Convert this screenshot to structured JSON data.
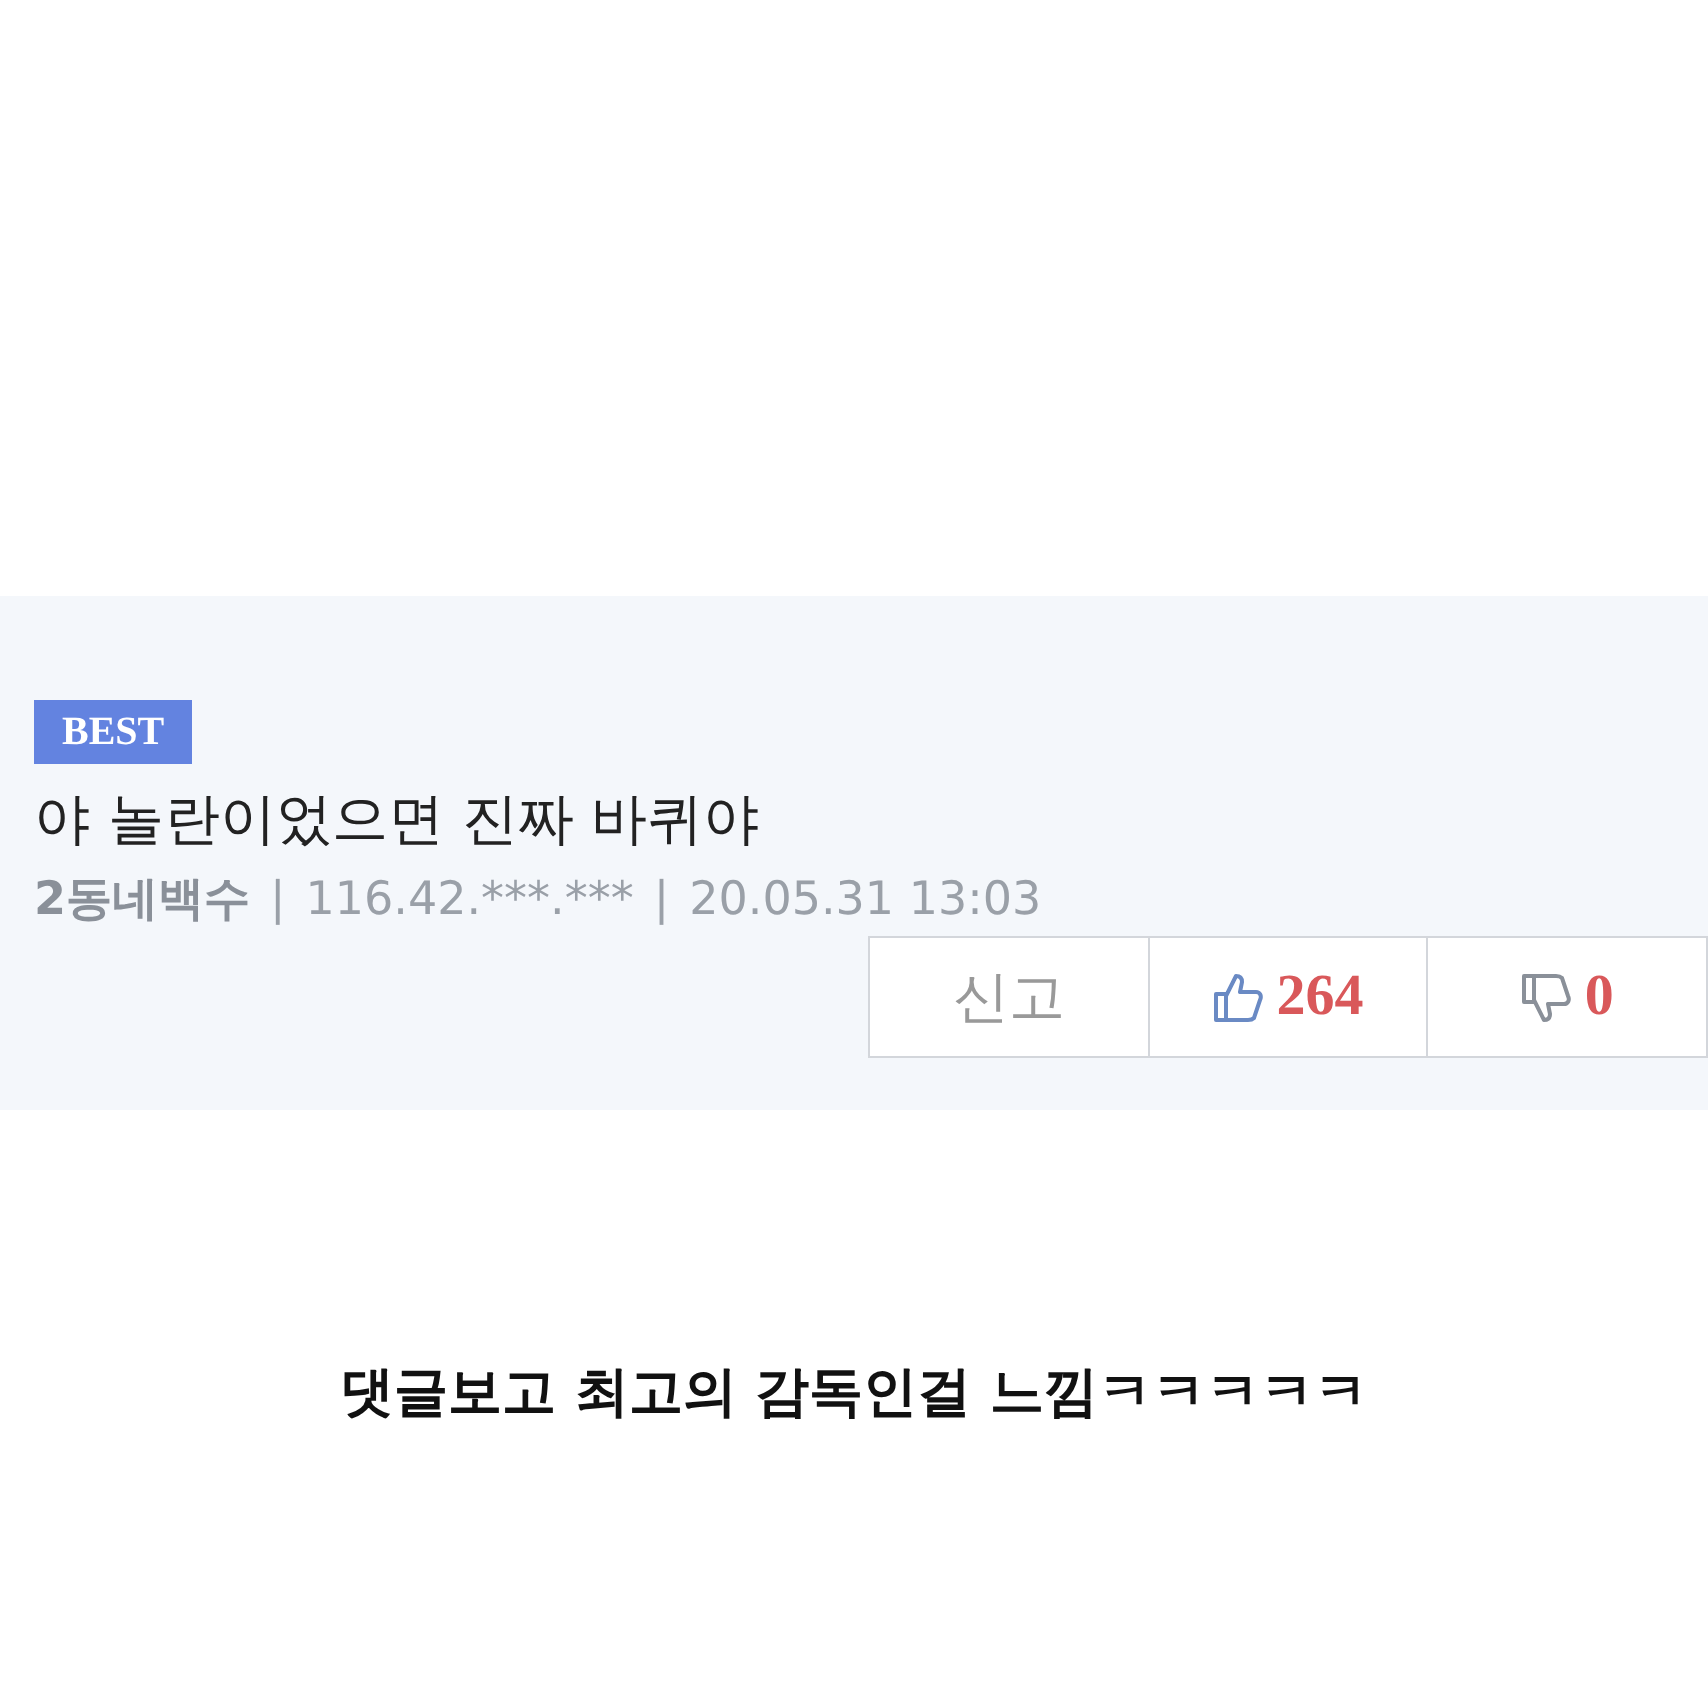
{
  "comment": {
    "badge": "BEST",
    "text": "야 놀란이었으면 진짜 바퀴야",
    "author": "2동네백수",
    "ip": "116.42.***.***",
    "date": "20.05.31 13:03",
    "separator": "|",
    "actions": [
      {
        "kind": "report",
        "label": "신고"
      },
      {
        "kind": "like",
        "count": "264"
      },
      {
        "kind": "dislike",
        "count": "0"
      }
    ]
  },
  "caption": "댓글보고 최고의 감독인걸 느낌ㅋㅋㅋㅋㅋ"
}
